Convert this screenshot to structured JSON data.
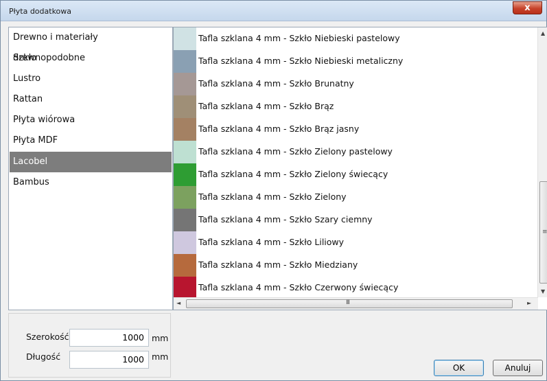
{
  "window": {
    "title": "Płyta dodatkowa",
    "close_glyph": "x"
  },
  "categories": [
    {
      "label": "Drewno i materiały drewnopodobne"
    },
    {
      "label": "Szkło"
    },
    {
      "label": "Lustro"
    },
    {
      "label": "Rattan"
    },
    {
      "label": "Płyta wiórowa"
    },
    {
      "label": "Płyta MDF"
    },
    {
      "label": "Lacobel",
      "selected": true
    },
    {
      "label": "Bambus"
    }
  ],
  "materials": [
    {
      "label": "Tafla szklana 4 mm - Szkło Niebieski pastelowy",
      "color": "#d0e2e4"
    },
    {
      "label": "Tafla szklana 4 mm - Szkło Niebieski metaliczny",
      "color": "#8aa0b3"
    },
    {
      "label": "Tafla szklana 4 mm - Szkło Brunatny",
      "color": "#a59895"
    },
    {
      "label": "Tafla szklana 4 mm - Szkło Brąz",
      "color": "#9f8f77"
    },
    {
      "label": "Tafla szklana 4 mm - Szkło Brąz jasny",
      "color": "#a48163"
    },
    {
      "label": "Tafla szklana 4 mm - Szkło Zielony pastelowy",
      "color": "#bee0d2"
    },
    {
      "label": "Tafla szklana 4 mm - Szkło Zielony świecący",
      "color": "#2e9d33"
    },
    {
      "label": "Tafla szklana 4 mm - Szkło Zielony",
      "color": "#7ca15f"
    },
    {
      "label": "Tafla szklana 4 mm - Szkło Szary ciemny",
      "color": "#757575"
    },
    {
      "label": "Tafla szklana 4 mm - Szkło Liliowy",
      "color": "#cfc8df"
    },
    {
      "label": "Tafla szklana 4 mm - Szkło Miedziany",
      "color": "#b66a3d"
    },
    {
      "label": "Tafla szklana 4 mm - Szkło Czerwony świecący",
      "color": "#b8152f"
    }
  ],
  "scrollbars": {
    "vertical": {
      "up": "▲",
      "down": "▼",
      "grip": "≡"
    },
    "horizontal": {
      "left": "◄",
      "right": "►",
      "grip": "III"
    }
  },
  "dimensions": {
    "width": {
      "label": "Szerokość",
      "value": "1000",
      "unit": "mm"
    },
    "length": {
      "label": "Długość",
      "value": "1000",
      "unit": "mm"
    }
  },
  "buttons": {
    "ok": "OK",
    "cancel": "Anuluj"
  }
}
